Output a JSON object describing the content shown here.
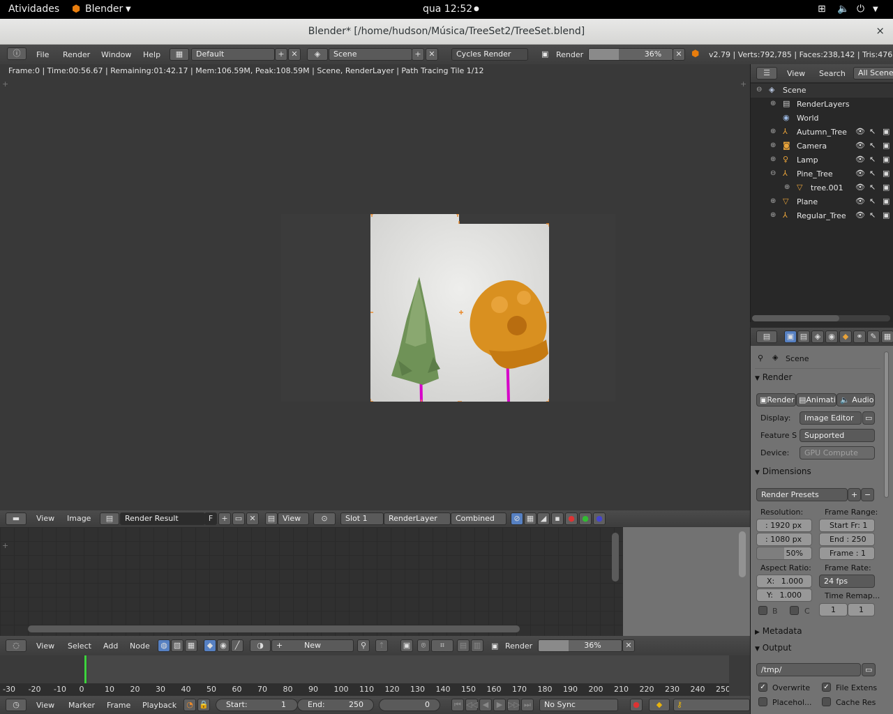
{
  "gnome": {
    "activities": "Atividades",
    "app": "Blender",
    "clock": "qua 12:52"
  },
  "window": {
    "title": "Blender* [/home/hudson/Música/TreeSet2/TreeSet.blend]",
    "close": "×"
  },
  "info": {
    "menus": [
      "File",
      "Render",
      "Window",
      "Help"
    ],
    "layout": "Default",
    "scene": "Scene",
    "engine": "Cycles Render",
    "render_label": "Render",
    "progress": "36%",
    "stats": "v2.79 | Verts:792,785 | Faces:238,142 | Tris:476,28"
  },
  "render_status": "Frame:0 | Time:00:56.67 | Remaining:01:42.17 | Mem:106.59M, Peak:108.59M | Scene, RenderLayer | Path Tracing Tile 1/12",
  "image_editor": {
    "menus": [
      "View",
      "Image"
    ],
    "image_name": "Render Result",
    "fake": "F",
    "view": "View",
    "slot": "Slot 1",
    "layer": "RenderLayer",
    "pass": "Combined"
  },
  "node_editor": {
    "menus": [
      "View",
      "Select",
      "Add",
      "Node"
    ],
    "new": "New",
    "render_label": "Render",
    "progress": "36%"
  },
  "timeline": {
    "ticks": [
      "-30",
      "-20",
      "-10",
      "0",
      "10",
      "20",
      "30",
      "40",
      "50",
      "60",
      "70",
      "80",
      "90",
      "100",
      "110",
      "120",
      "130",
      "140",
      "150",
      "160",
      "170",
      "180",
      "190",
      "200",
      "210",
      "220",
      "230",
      "240",
      "250"
    ],
    "menus": [
      "View",
      "Marker",
      "Frame",
      "Playback"
    ],
    "start_label": "Start:",
    "start": "1",
    "end_label": "End:",
    "end": "250",
    "current": "0",
    "sync": "No Sync",
    "current_frame_marker": 0
  },
  "outliner": {
    "menus": [
      "View",
      "Search"
    ],
    "filter": "All Scenes",
    "items": [
      {
        "name": "Scene",
        "icon": "scene-icon"
      },
      {
        "name": "RenderLayers",
        "icon": "render-layers-icon"
      },
      {
        "name": "World",
        "icon": "world-icon"
      },
      {
        "name": "Autumn_Tree",
        "icon": "empty-icon"
      },
      {
        "name": "Camera",
        "icon": "camera-icon"
      },
      {
        "name": "Lamp",
        "icon": "lamp-icon"
      },
      {
        "name": "Pine_Tree",
        "icon": "empty-icon"
      },
      {
        "name": "tree.001",
        "icon": "mesh-icon"
      },
      {
        "name": "Plane",
        "icon": "mesh-icon"
      },
      {
        "name": "Regular_Tree",
        "icon": "empty-icon"
      }
    ]
  },
  "properties": {
    "scene": "Scene",
    "render_panel": "Render",
    "btn_render": "Render",
    "btn_anim": "Animati",
    "btn_audio": "Audio",
    "display_label": "Display:",
    "display": "Image Editor",
    "feature_label": "Feature S",
    "feature": "Supported",
    "device_label": "Device:",
    "device": "GPU Compute",
    "dimensions_panel": "Dimensions",
    "presets": "Render Presets",
    "resolution_label": "Resolution:",
    "res_x": ": 1920 px",
    "res_y": ": 1080 px",
    "res_pct": "50%",
    "frame_range_label": "Frame Range:",
    "start_fr": "Start Fr: 1",
    "end_fr": "End : 250",
    "frame_step": "Frame : 1",
    "aspect_label": "Aspect Ratio:",
    "aspect_x_label": "X:",
    "aspect_x": "1.000",
    "aspect_y_label": "Y:",
    "aspect_y": "1.000",
    "frame_rate_label": "Frame Rate:",
    "fps": "24 fps",
    "time_remap_label": "Time Remap...",
    "b": "B",
    "c": "C",
    "remap_old": "1",
    "remap_new": "1",
    "metadata_panel": "Metadata",
    "output_panel": "Output",
    "path": "/tmp/",
    "overwrite": "Overwrite",
    "file_ext": "File Extens",
    "placeholders": "Placehol...",
    "cache": "Cache Res"
  },
  "colors": {
    "accent": "#5680c2",
    "progress": "#ea8a2c",
    "playhead": "#3dd43d",
    "magenta": "#d600c8"
  }
}
